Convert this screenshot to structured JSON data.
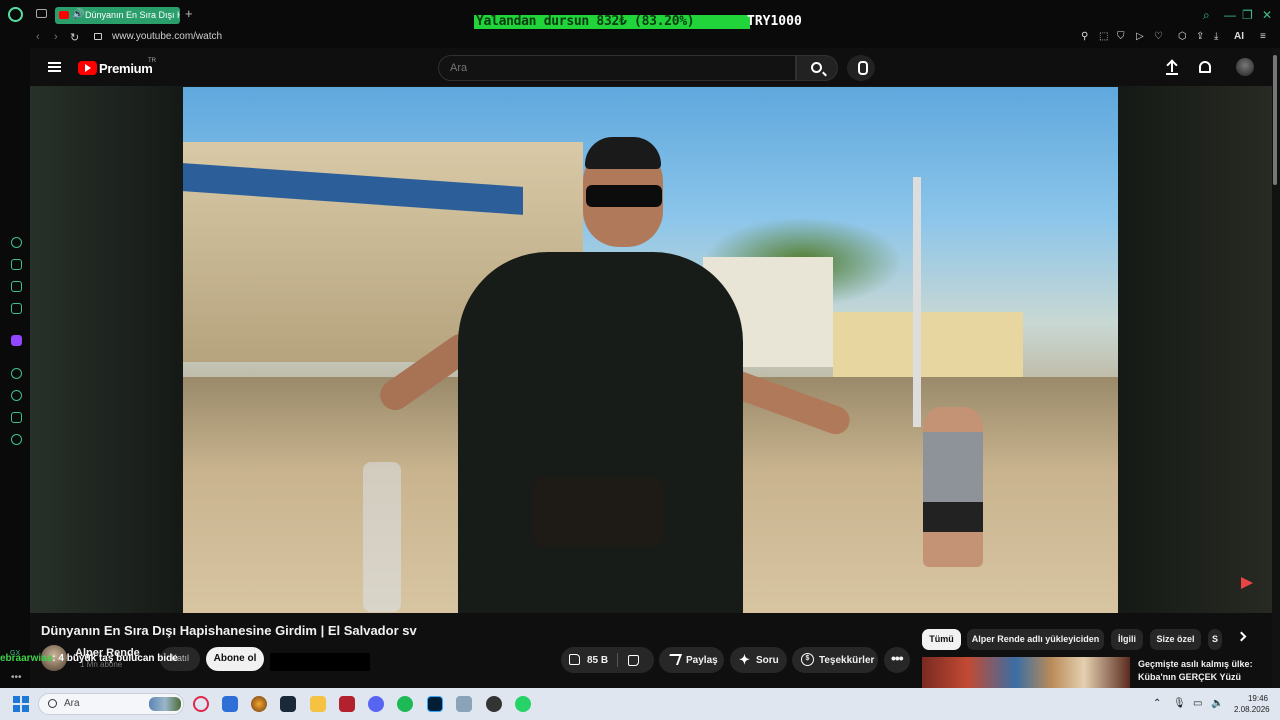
{
  "browser": {
    "tab_title": "Dünyanın En Sıra Dışı Ha",
    "new_tab_label": "+",
    "url": "www.youtube.com/watch",
    "ai_label": "AI"
  },
  "overlay": {
    "donation_text": "Yalandan dursun 832₺ (83.20%)",
    "donation_progress": 0.832,
    "donation_goal": "TRY1000",
    "donation_color": "#20d43a"
  },
  "youtube": {
    "logo_text": "Premium",
    "region": "TR",
    "search_placeholder": "Ara"
  },
  "video": {
    "title": "Dünyanın En Sıra Dışı Hapishanesine Girdim | El Salvador sv",
    "channel_name": "Alper Rende",
    "channel_subs": "1 Mn abone",
    "join_label": "Katıl",
    "subscribe_label": "Abone ol",
    "like_count": "85 B",
    "share_label": "Paylaş",
    "ask_label": "Soru",
    "thanks_label": "Teşekkürler",
    "more_label": "•••"
  },
  "chat": {
    "user": "ebraarwiaa",
    "message": ": 4 büyük taş bulucan bide"
  },
  "chips": {
    "all": "Tümü",
    "uploader": "Alper Rende adlı yükleyiciden",
    "related": "İlgili",
    "for_you": "Size özel",
    "partial": "S"
  },
  "recommendation": {
    "title_line1": "Geçmişte asılı kalmış ülke:",
    "title_line2": "Küba'nın GERÇEK Yüzü"
  },
  "sidebar": {
    "gx_label": "GX",
    "more_label": "•••"
  },
  "taskbar": {
    "search_label": "Ara",
    "time": "19:46",
    "date": "2.08.2026"
  }
}
